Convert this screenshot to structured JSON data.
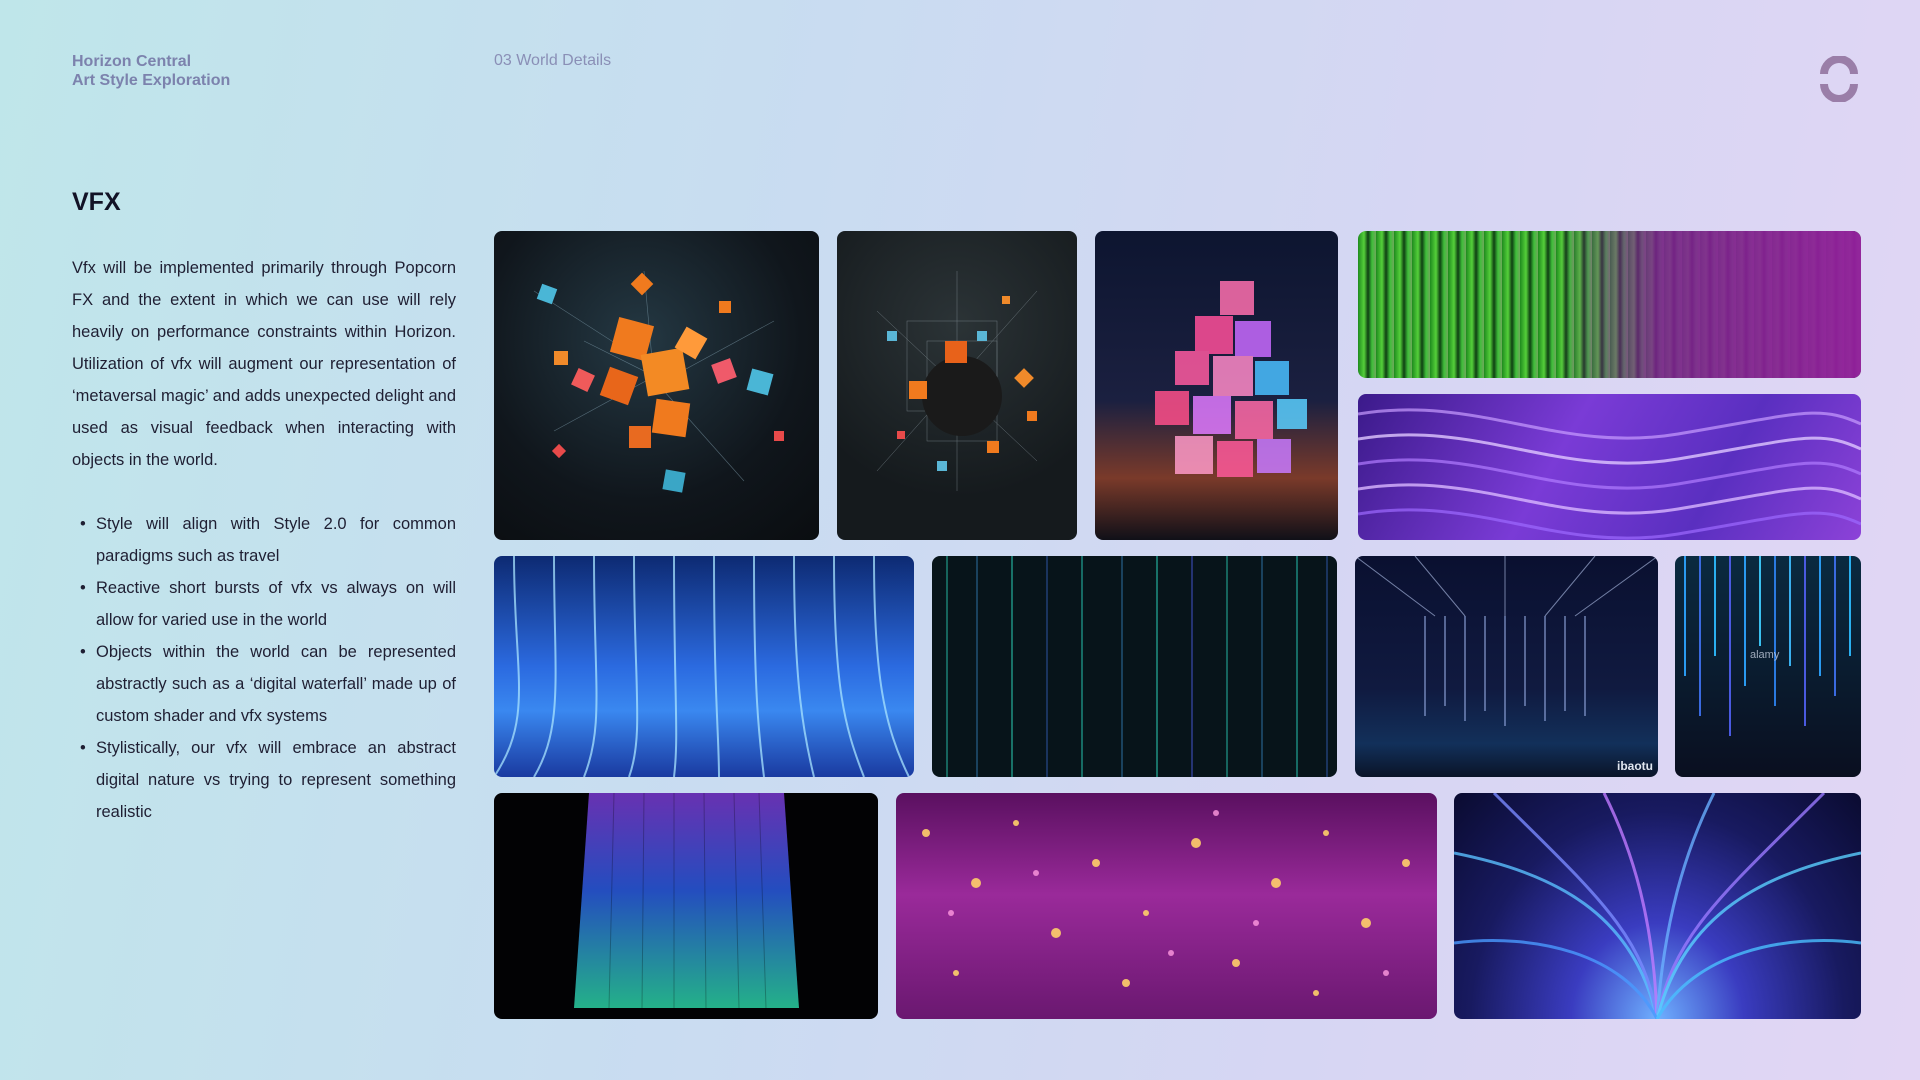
{
  "header": {
    "project_line1": "Horizon Central",
    "project_line2": "Art Style Exploration",
    "section": "03 World Details",
    "logo_icon": "meta-loop-logo-icon"
  },
  "content": {
    "title": "VFX",
    "paragraph": "Vfx will be implemented primarily through Popcorn FX and the extent in which we can use will rely heavily on performance constraints within Horizon. Utilization of vfx will augment our representation of ‘metaversal magic’ and adds unexpected delight and used as visual feedback when interacting with objects in the world.",
    "bullets": [
      "Style will align with Style 2.0 for common paradigms such as travel",
      "Reactive short bursts of vfx vs always on will allow for varied use in the world",
      "Objects within the world can be represented abstractly such as a ‘digital waterfall’ made up of custom shader and vfx systems",
      "Stylistically, our vfx will embrace an abstract digital nature vs trying to represent something realistic"
    ],
    "bullet_glyph": "•"
  },
  "gallery": {
    "watermark_ibaotu": "ibaotu",
    "watermark_alamy": "alamy"
  },
  "colors": {
    "accent_text": "#7c82ad",
    "logo": "#9a7ea8"
  }
}
